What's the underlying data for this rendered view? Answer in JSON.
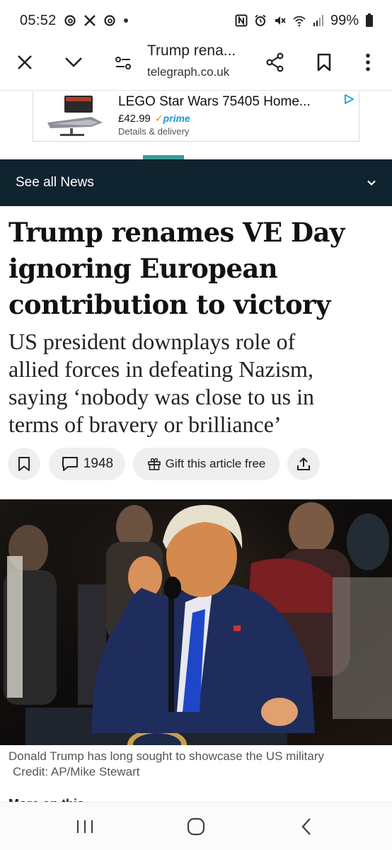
{
  "status_bar": {
    "time": "05:52",
    "battery": "99%",
    "left_icons": [
      "threads-icon",
      "x-icon",
      "threads-icon"
    ],
    "right_icons": [
      "nfc-icon",
      "alarm-icon",
      "mute-icon",
      "wifi-icon",
      "signal-icon",
      "battery-icon"
    ]
  },
  "toolbar": {
    "title": "Trump rena...",
    "url": "telegraph.co.uk"
  },
  "ad": {
    "title": "LEGO Star Wars 75405 Home...",
    "price": "£42.99",
    "prime": "prime",
    "details": "Details & delivery"
  },
  "section_nav": {
    "label": "See all News"
  },
  "article": {
    "headline_lines": [
      "Trump renames VE Day",
      "ignoring European",
      "contribution to victory"
    ],
    "standfirst_lines": [
      "US president downplays role of",
      "allied forces in defeating Nazism,",
      "saying ‘nobody was close to us in",
      "terms of bravery or brilliance’"
    ],
    "comment_count": "1948",
    "gift_label": "Gift this article free",
    "image_caption": "Donald Trump has long sought to showcase the US military",
    "image_credit": "Credit: AP/Mike Stewart",
    "more_label": "More on this"
  },
  "colors": {
    "section_bar": "#10242f",
    "accent_teal": "#3a9c97",
    "prime_blue": "#1a98d5"
  }
}
